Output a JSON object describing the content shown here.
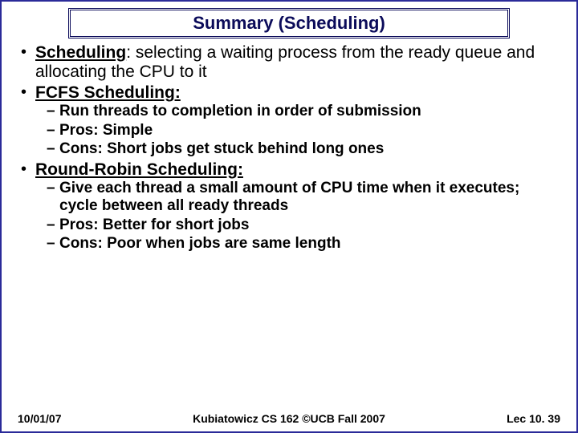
{
  "title": "Summary (Scheduling)",
  "bullets": {
    "scheduling_term": "Scheduling",
    "scheduling_def": ": selecting a waiting process from the ready queue and allocating the CPU to it",
    "fcfs_term": "FCFS Scheduling:",
    "fcfs_sub": [
      "Run threads to completion in order of submission",
      "Pros: Simple",
      "Cons: Short jobs get stuck behind long ones"
    ],
    "rr_term": "Round-Robin Scheduling:",
    "rr_sub": [
      "Give each thread a small amount of CPU time when it executes; cycle between all ready threads",
      "Pros: Better for short jobs",
      "Cons: Poor when jobs are same length"
    ]
  },
  "footer": {
    "date": "10/01/07",
    "center": "Kubiatowicz CS 162 ©UCB Fall 2007",
    "right": "Lec 10. 39"
  }
}
